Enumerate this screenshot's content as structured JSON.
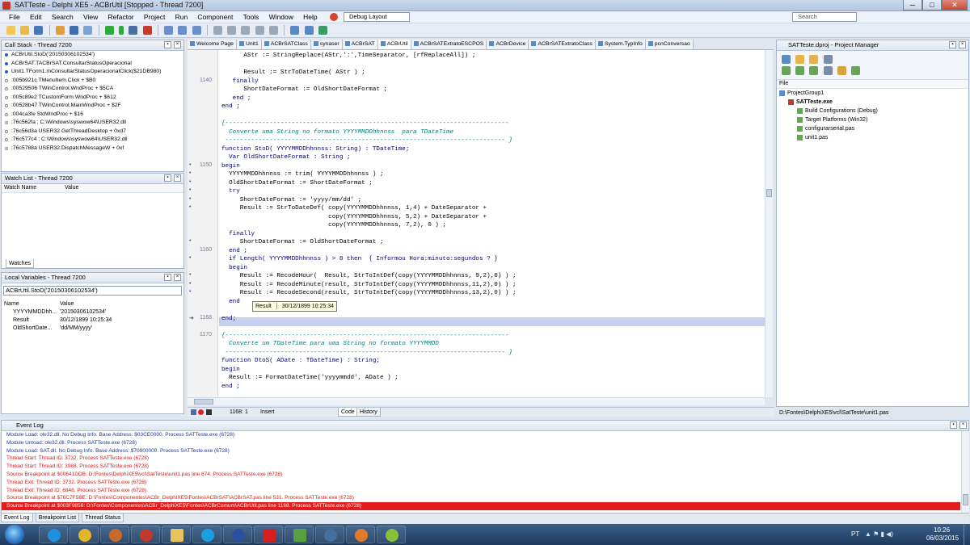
{
  "window": {
    "title": "SATTeste - Delphi XE5 - ACBrUtil [Stopped - Thread 7200]",
    "min": "─",
    "max": "□",
    "close": "✕"
  },
  "menu": [
    "File",
    "Edit",
    "Search",
    "View",
    "Refactor",
    "Project",
    "Run",
    "Component",
    "Tools",
    "Window",
    "Help"
  ],
  "toolbar": {
    "layout_combo": "Debug Layout",
    "search_placeholder": "Search"
  },
  "call_stack": {
    "title": "Call Stack - Thread 7200",
    "items": [
      "ACBrUtil.StoD('20150306102534')",
      "ACBrSAT.TACBrSAT.ConsultarStatusOperacional",
      "Unit1.TForm1.mConsultarStatusOperacionalClick($21DB980)",
      ":005b921c TMenuItem.Click + $B0",
      ":00529506 TWinControl.WndProc + $5CA",
      ":005c89e2 TCustomForm.WndProc + $612",
      ":00528b47 TWinControl.MainWndProc + $2F",
      ":004ca3fe StdWndProc + $16",
      ":76c562fa ; C:\\Windows\\syswow64\\USER32.dll",
      ":76c56d3a USER32.GetThreadDesktop + 0xd7",
      ":76c577c4 ; C:\\Windows\\syswow64\\USER32.dll",
      ":76c5788a USER32.DispatchMessageW + 0xf"
    ]
  },
  "watch_list": {
    "title": "Watch List - Thread 7200",
    "col_name": "Watch Name",
    "col_value": "Value",
    "tab": "Watches"
  },
  "local_vars": {
    "title": "Local Variables - Thread 7200",
    "combo": "ACBrUtil.StoD('20150306102534')",
    "col_name": "Name",
    "col_value": "Value",
    "rows": [
      {
        "name": "YYYYMMDDhh...",
        "value": "'20150306102534'"
      },
      {
        "name": "Result",
        "value": "30/12/1899 10:25:34"
      },
      {
        "name": "OldShortDate...",
        "value": "'dd/MM/yyyy'"
      }
    ]
  },
  "editor_tabs": [
    "Welcome Page",
    "Unit1",
    "ACBrSATClass",
    "synaser",
    "ACBrSAT",
    "ACBrUtil",
    "ACBrSATExtratoESCPOS",
    "ACBrDevice",
    "ACBrSATExtratoClass",
    "System.TypInfo",
    "pcnConversao"
  ],
  "code": [
    {
      "g": "",
      "n": "",
      "t": "      AStr := StringReplace(AStr,':',TimeSeparator, [rfReplaceAll]) ;"
    },
    {
      "g": "",
      "n": "",
      "t": ""
    },
    {
      "g": "",
      "n": "",
      "t": "      Result := StrToDateTime( AStr ) ;"
    },
    {
      "g": "",
      "n": "1140",
      "t": "   finally"
    },
    {
      "g": "",
      "n": "",
      "t": "      ShortDateFormat := OldShortDateFormat ;"
    },
    {
      "g": "",
      "n": "",
      "t": "   end ;"
    },
    {
      "g": "",
      "n": "",
      "t": "end ;"
    },
    {
      "g": "",
      "n": "",
      "t": ""
    },
    {
      "g": "",
      "n": "",
      "t": "{-----------------------------------------------------------------------------"
    },
    {
      "g": "",
      "n": "",
      "t": "  Converte uma String no formato YYYYMMDDhhnnss  para TDateTime"
    },
    {
      "g": "",
      "n": "",
      "t": " ---------------------------------------------------------------------------- }"
    },
    {
      "g": "",
      "n": "",
      "t": "function StoD( YYYYMMDDhhnnss: String) : TDateTime;"
    },
    {
      "g": "",
      "n": "",
      "t": "  Var OldShortDateFormat : String ;"
    },
    {
      "g": "•",
      "n": "1150",
      "t": "begin"
    },
    {
      "g": "•",
      "n": "",
      "t": "  YYYYMMDDhhnnss := trim( YYYYMMDDhhnnss ) ;"
    },
    {
      "g": "•",
      "n": "",
      "t": "  OldShortDateFormat := ShortDateFormat ;"
    },
    {
      "g": "•",
      "n": "",
      "t": "  try"
    },
    {
      "g": "•",
      "n": "",
      "t": "     ShortDateFormat := 'yyyy/mm/dd' ;"
    },
    {
      "g": "•",
      "n": "",
      "t": "     Result := StrToDateDef( copy(YYYYMMDDhhnnss, 1,4) + DateSeparator +"
    },
    {
      "g": "",
      "n": "",
      "t": "                             copy(YYYYMMDDhhnnss, 5,2) + DateSeparator +"
    },
    {
      "g": "",
      "n": "",
      "t": "                             copy(YYYYMMDDhhnnss, 7,2), 0 ) ;"
    },
    {
      "g": "",
      "n": "",
      "t": "  finally"
    },
    {
      "g": "•",
      "n": "",
      "t": "     ShortDateFormat := OldShortDateFormat ;"
    },
    {
      "g": "",
      "n": "1160",
      "t": "  end ;"
    },
    {
      "g": "•",
      "n": "",
      "t": "  if Length( YYYYMMDDhhnnss ) > 8 then  { Informou Hora:minuto:segundos ? }"
    },
    {
      "g": "",
      "n": "",
      "t": "  begin"
    },
    {
      "g": "•",
      "n": "",
      "t": "     Result := RecodeHour(  Result, StrToIntDef(copy(YYYYMMDDhhnnss, 9,2),0) ) ;"
    },
    {
      "g": "•",
      "n": "",
      "t": "     Result := RecodeMinute(result, StrToIntDef(copy(YYYYMMDDhhnnss,11,2),0) ) ;"
    },
    {
      "g": "•",
      "n": "",
      "t": "     Result := RecodeSecond(result, StrToIntDef(copy(YYYYMMDDhhnnss,13,2),0) ) ;"
    },
    {
      "g": "",
      "n": "",
      "t": "  end"
    },
    {
      "g": "",
      "n": "",
      "t": ""
    },
    {
      "g": "➜",
      "n": "1168",
      "t": "end;"
    },
    {
      "g": "",
      "n": "",
      "t": ""
    },
    {
      "g": "",
      "n": "1170",
      "t": "{-----------------------------------------------------------------------------"
    },
    {
      "g": "",
      "n": "",
      "t": "  Converte um TDateTime para uma String no formato YYYYMMDD"
    },
    {
      "g": "",
      "n": "",
      "t": " ---------------------------------------------------------------------------- }"
    },
    {
      "g": "",
      "n": "",
      "t": "function DtoS( ADate : TDateTime) : String;"
    },
    {
      "g": "",
      "n": "",
      "t": "begin"
    },
    {
      "g": "",
      "n": "",
      "t": "  Result := FormatDateTime('yyyymmdd', ADate ) ;"
    },
    {
      "g": "",
      "n": "",
      "t": "end ;"
    }
  ],
  "tooltip": {
    "label": "Result",
    "value": "30/12/1899 10:25:34"
  },
  "editor_status": {
    "position": "1168:  1",
    "mode": "Insert",
    "tab_code": "Code",
    "tab_history": "History"
  },
  "project_manager": {
    "title": "SATTeste.dproj - Project Manager",
    "file_label": "File",
    "items": [
      {
        "label": "ProjectGroup1",
        "level": 0
      },
      {
        "label": "SATTeste.exe",
        "level": 1
      },
      {
        "label": "Build Configurations (Debug)",
        "level": 2
      },
      {
        "label": "Target Platforms (Win32)",
        "level": 2
      },
      {
        "label": "configurarserial.pas",
        "level": 2
      },
      {
        "label": "unit1.pas",
        "level": 2
      }
    ],
    "path": "D:\\Fontes\\DelphiXE5\\vcl\\SatTeste\\unit1.pas"
  },
  "event_log": {
    "title": "Event Log",
    "rows": [
      {
        "text": "Module Load: ole32.dll. No Debug Info. Base Address: $03CE0000. Process SATTeste.exe (6728)",
        "kind": "module"
      },
      {
        "text": "Module Unload: ole32.dll. Process SATTeste.exe (6728)",
        "kind": "module"
      },
      {
        "text": "Module Load: SAT.dll. No Debug Info. Base Address: $70900000. Process SATTeste.exe (6728)",
        "kind": "module"
      },
      {
        "text": "Thread Start: Thread ID: 3732. Process SATTeste.exe (6728)",
        "kind": "thread"
      },
      {
        "text": "Thread Start: Thread ID: 3988. Process SATTeste.exe (6728)",
        "kind": "thread"
      },
      {
        "text": "Source Breakpoint at $00641DDB: D:\\Fontes\\DelphiXE5\\vcl\\SatTeste\\unit1.pas line 674. Process SATTeste.exe (6728)",
        "kind": "thread"
      },
      {
        "text": "Thread Exit: Thread ID: 3732. Process SATTeste.exe (6728)",
        "kind": "thread"
      },
      {
        "text": "Thread Exit: Thread ID: 6848. Process SATTeste.exe (6728)",
        "kind": "thread"
      },
      {
        "text": "Source Breakpoint at $76C7F5BE: D:\\Fontes\\Componentes\\ACBr_DelphiXE5\\Fontes\\ACBrSAT\\ACBrSAT.pas line 531. Process SATTeste.exe (6728)",
        "kind": "thread"
      },
      {
        "text": "Source Breakpoint at $003F9856: D:\\Fontes\\Componentes\\ACBr_DelphiXE5\\Fontes\\ACBrComum\\ACBrUtil.pas line 1168. Process SATTeste.exe (6728)",
        "kind": "current"
      }
    ],
    "tabs": [
      "Event Log",
      "Breakpoint List",
      "Thread Status"
    ]
  },
  "taskbar": {
    "lang": "PT",
    "time": "10:26",
    "date": "06/03/2015"
  },
  "colors": {
    "accent": "#2b5797",
    "current_line": "#c8d0f0",
    "error_red": "#cc2222",
    "module_blue": "#1a3a9a",
    "selected_event": "#e51c1c"
  }
}
